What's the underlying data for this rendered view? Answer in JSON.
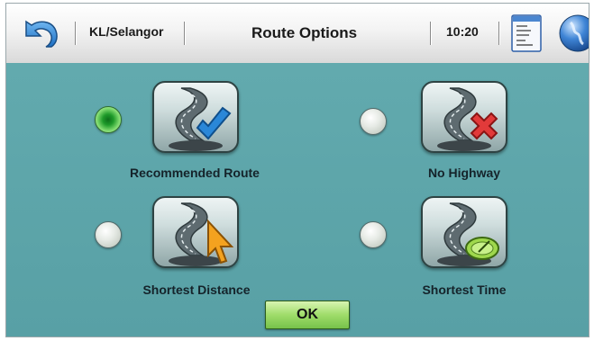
{
  "header": {
    "region": "KL/Selangor",
    "title": "Route Options",
    "time": "10:20"
  },
  "options": [
    {
      "label": "Recommended Route",
      "selected": true,
      "icon": "road-checkmark-icon"
    },
    {
      "label": "No Highway",
      "selected": false,
      "icon": "road-cross-icon"
    },
    {
      "label": "Shortest Distance",
      "selected": false,
      "icon": "road-cursor-icon"
    },
    {
      "label": "Shortest Time",
      "selected": false,
      "icon": "road-clock-icon"
    }
  ],
  "ok_label": "OK",
  "colors": {
    "background": "#5ea6aa",
    "selected_radio": "#1e9a2a",
    "ok_button": "#9fdc6a"
  }
}
